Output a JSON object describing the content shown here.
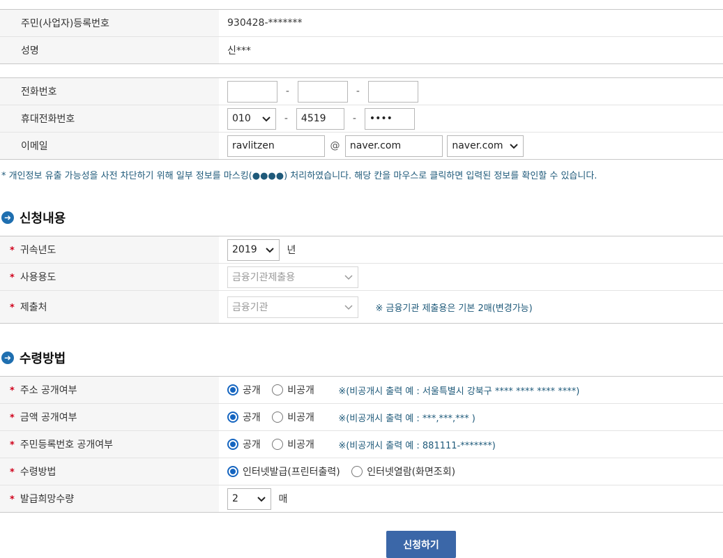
{
  "identity": {
    "rows": [
      {
        "label": "주민(사업자)등록번호",
        "value": "930428-*******"
      },
      {
        "label": "성명",
        "value": "신***"
      }
    ]
  },
  "contact": {
    "phone_label": "전화번호",
    "phone": [
      "",
      "",
      ""
    ],
    "mobile_label": "휴대전화번호",
    "mobile_prefix": "010",
    "mobile_mid": "4519",
    "mobile_last": "••••",
    "email_label": "이메일",
    "email_id": "ravlitzen",
    "email_at": "@",
    "email_domain": "naver.com",
    "email_domain_select": "naver.com",
    "dash": "-"
  },
  "notice": "* 개인정보 유출 가능성을 사전 차단하기 위해 일부 정보를 마스킹(●●●●) 처리하였습니다. 해당 칸을 마우스로 클릭하면 입력된 정보를 확인할 수 있습니다.",
  "section_apply": {
    "title": "신청내용",
    "required_mark": "*",
    "year_label": "귀속년도",
    "year_value": "2019",
    "year_unit": "년",
    "usage_label": "사용용도",
    "usage_value": "금융기관제출용",
    "submit_to_label": "제출처",
    "submit_to_value": "금융기관",
    "submit_to_hint": "※ 금융기관 제출용은 기본 2매(변경가능)"
  },
  "section_receive": {
    "title": "수령방법",
    "address_label": "주소 공개여부",
    "amount_label": "금액 공개여부",
    "rrn_label": "주민등록번호 공개여부",
    "public": "공개",
    "private": "비공개",
    "address_hint": "※(비공개시 출력 예 : 서울특별시 강북구 **** **** **** ****)",
    "amount_hint": "※(비공개시 출력 예 : ***,***,*** )",
    "rrn_hint": "※(비공개시 출력 예 : 881111-*******)",
    "method_label": "수령방법",
    "method_print": "인터넷발급(프린터출력)",
    "method_view": "인터넷열람(화면조회)",
    "copies_label": "발급희망수량",
    "copies_value": "2",
    "copies_unit": "매"
  },
  "submit_label": "신청하기",
  "colors": {
    "accent": "#1565c0",
    "button": "#3b67a8",
    "required": "#d0021b",
    "hint": "#1f5a7a"
  }
}
